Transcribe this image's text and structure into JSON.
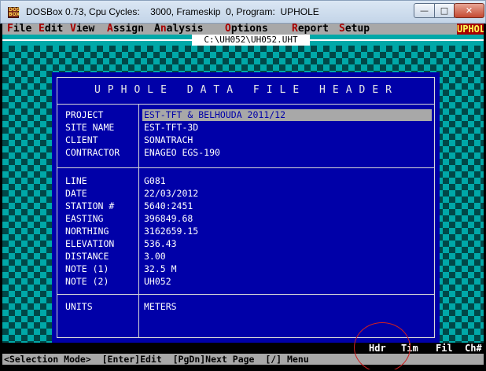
{
  "window": {
    "title": "DOSBox 0.73, Cpu Cycles:    3000, Frameskip  0, Program:  UPHOLE",
    "icon_text": "DOS BOX"
  },
  "menu": {
    "items": [
      {
        "hot": "F",
        "rest": "ile"
      },
      {
        "hot": "E",
        "rest": "dit"
      },
      {
        "hot": "V",
        "rest": "iew"
      },
      {
        "hot": "A",
        "rest": "ssign"
      },
      {
        "pre": "A",
        "hot": "n",
        "rest": "alysis"
      },
      {
        "hot": "O",
        "rest": "ptions"
      },
      {
        "hot": "R",
        "rest": "eport"
      },
      {
        "hot": "S",
        "rest": "etup"
      }
    ],
    "logo": "UPHOLE"
  },
  "file": {
    "path": "C:\\UH052\\UH052.UHT"
  },
  "dialog": {
    "title": "UPHOLE DATA FILE HEADER",
    "project_fields": [
      {
        "label": "PROJECT",
        "value": "EST-TFT & BELHOUDA 2011/12"
      },
      {
        "label": "SITE NAME",
        "value": "EST-TFT-3D"
      },
      {
        "label": "CLIENT",
        "value": "SONATRACH"
      },
      {
        "label": "CONTRACTOR",
        "value": "ENAGEO EGS-190"
      }
    ],
    "location_fields": [
      {
        "label": "LINE",
        "value": "G081"
      },
      {
        "label": "DATE",
        "value": "22/03/2012"
      },
      {
        "label": "STATION #",
        "value": "5640:2451"
      },
      {
        "label": "EASTING",
        "value": "396849.68"
      },
      {
        "label": "NORTHING",
        "value": "3162659.15"
      },
      {
        "label": "ELEVATION",
        "value": "536.43"
      },
      {
        "label": "DISTANCE",
        "value": "3.00"
      },
      {
        "label": "NOTE (1)",
        "value": "32.5 M"
      },
      {
        "label": "NOTE (2)",
        "value": "UH052"
      }
    ],
    "units": {
      "label": "UNITS",
      "value": "METERS"
    }
  },
  "tabs": [
    "Hdr",
    "Tim",
    "Fil",
    "Ch#"
  ],
  "active_tab": "Hdr",
  "status_hints": "<Selection Mode>  [Enter]Edit  [PgDn]Next Page  [/] Menu"
}
